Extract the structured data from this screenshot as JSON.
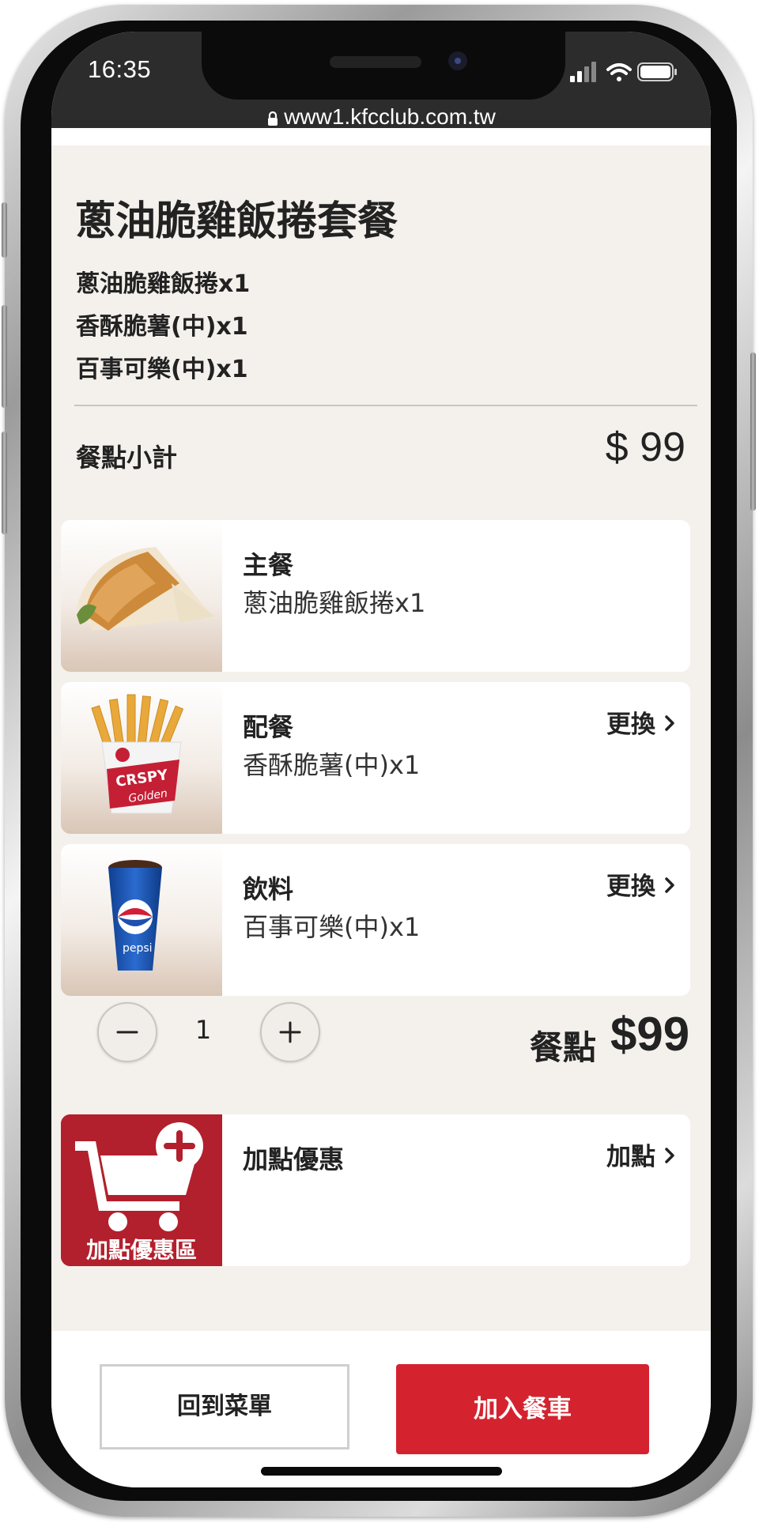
{
  "status_bar": {
    "time": "16:35",
    "url": "www1.kfcclub.com.tw"
  },
  "header": {
    "title": "蔥油脆雞飯捲套餐",
    "items": [
      "蔥油脆雞飯捲x1",
      "香酥脆薯(中)x1",
      "百事可樂(中)x1"
    ]
  },
  "subtotal": {
    "label": "餐點小計",
    "price": "$ 99"
  },
  "cards": [
    {
      "category": "主餐",
      "item": "蔥油脆雞飯捲x1",
      "link": "",
      "icon": "wrap-image"
    },
    {
      "category": "配餐",
      "item": "香酥脆薯(中)x1",
      "link": "更換",
      "icon": "fries-image"
    },
    {
      "category": "飲料",
      "item": "百事可樂(中)x1",
      "link": "更換",
      "icon": "cola-image"
    }
  ],
  "quantity": {
    "value": "1",
    "meal_label": "餐點",
    "meal_price": "$99"
  },
  "addon": {
    "title": "加點優惠",
    "link": "加點",
    "image_caption": "加點優惠區"
  },
  "footer": {
    "back_label": "回到菜單",
    "add_label": "加入餐車"
  },
  "colors": {
    "brand_red": "#d4232f",
    "addon_red": "#b2202d",
    "bg": "#f4f0ec"
  }
}
